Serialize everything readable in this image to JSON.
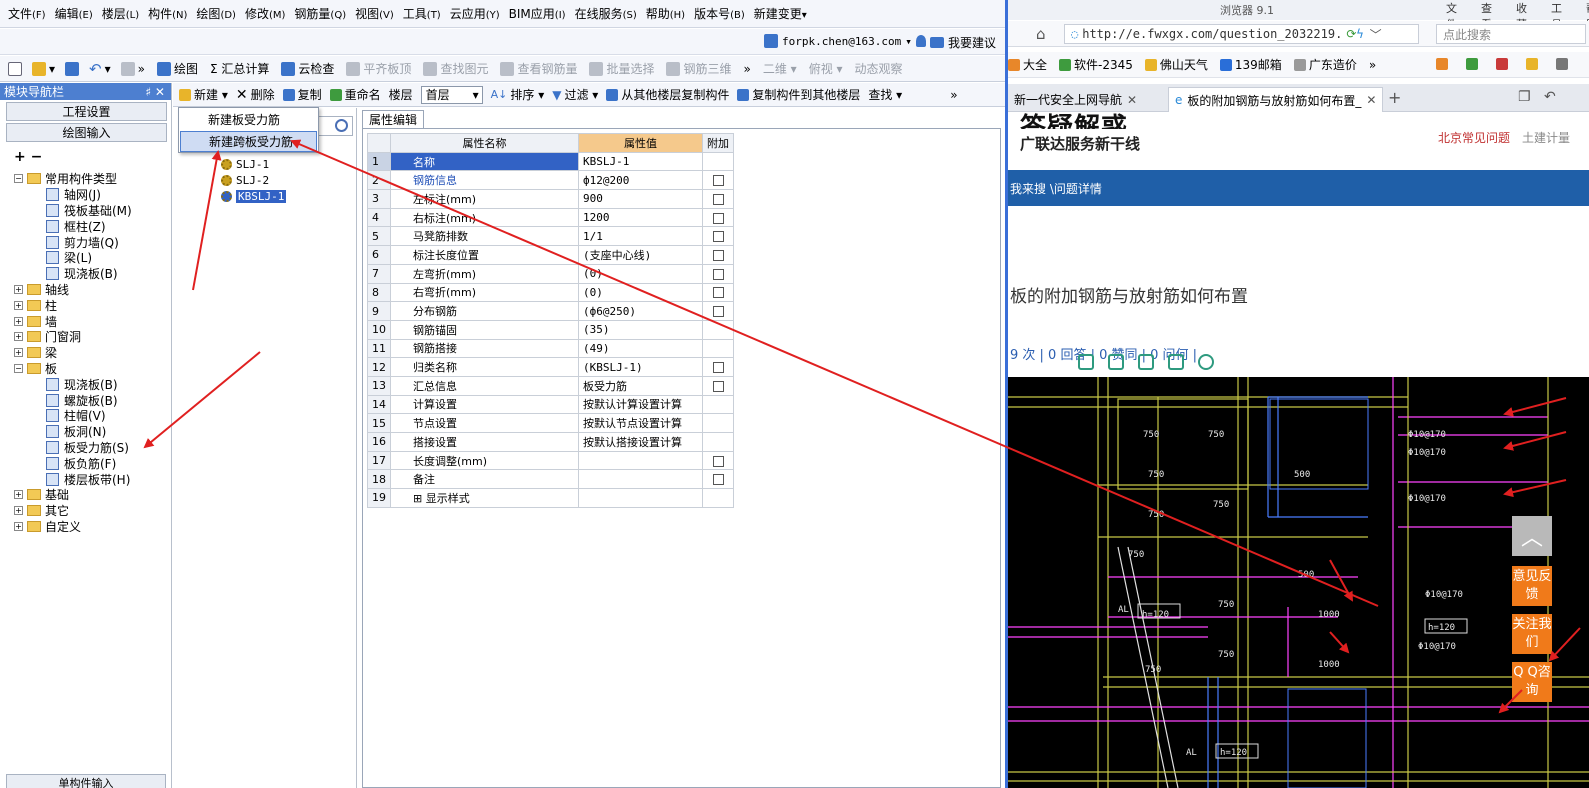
{
  "menubar": {
    "items": [
      {
        "label": "文件",
        "key": "(F)"
      },
      {
        "label": "编辑",
        "key": "(E)"
      },
      {
        "label": "楼层",
        "key": "(L)"
      },
      {
        "label": "构件",
        "key": "(N)"
      },
      {
        "label": "绘图",
        "key": "(D)"
      },
      {
        "label": "修改",
        "key": "(M)"
      },
      {
        "label": "钢筋量",
        "key": "(Q)"
      },
      {
        "label": "视图",
        "key": "(V)"
      },
      {
        "label": "工具",
        "key": "(T)"
      },
      {
        "label": "云应用",
        "key": "(Y)"
      },
      {
        "label": "BIM应用",
        "key": "(I)"
      },
      {
        "label": "在线服务",
        "key": "(S)"
      },
      {
        "label": "帮助",
        "key": "(H)"
      },
      {
        "label": "版本号",
        "key": "(B)"
      },
      {
        "label": "新建变更",
        "key": "▾"
      }
    ]
  },
  "userbar": {
    "user": "forpk.chen@163.com",
    "advice": "我要建议"
  },
  "toolbar": {
    "items": [
      {
        "label": "»",
        "icon": "more-icon"
      },
      {
        "label": "绘图",
        "icon": "draw-icon"
      },
      {
        "label": "Σ 汇总计算",
        "icon": ""
      },
      {
        "label": "云检查",
        "icon": "cloud-check-icon"
      },
      {
        "label": "平齐板顶",
        "icon": "flush-top-icon",
        "disabled": true
      },
      {
        "label": "查找图元",
        "icon": "find-element-icon",
        "disabled": true
      },
      {
        "label": "查看钢筋量",
        "icon": "view-rebar-icon",
        "disabled": true
      },
      {
        "label": "批量选择",
        "icon": "batch-select-icon",
        "disabled": true
      },
      {
        "label": "钢筋三维",
        "icon": "rebar-3d-icon",
        "disabled": true
      },
      {
        "label": "»",
        "icon": ""
      },
      {
        "label": "二维 ▾",
        "icon": "",
        "disabled": true
      },
      {
        "label": "俯视 ▾",
        "icon": "",
        "disabled": true
      },
      {
        "label": "动态观察",
        "icon": "",
        "disabled": true
      }
    ]
  },
  "nav": {
    "title": "模块导航栏",
    "title_controls": "♯ ✕",
    "engineering": "工程设置",
    "drawing_input": "绘图输入",
    "plusminus": "+ −",
    "bottom": "单构件输入",
    "tree": [
      {
        "label": "常用构件类型",
        "level": 0,
        "exp": "−"
      },
      {
        "label": "轴网(J)",
        "level": 1
      },
      {
        "label": "筏板基础(M)",
        "level": 1
      },
      {
        "label": "框柱(Z)",
        "level": 1
      },
      {
        "label": "剪力墙(Q)",
        "level": 1
      },
      {
        "label": "梁(L)",
        "level": 1
      },
      {
        "label": "现浇板(B)",
        "level": 1
      },
      {
        "label": "轴线",
        "level": 0,
        "exp": "+"
      },
      {
        "label": "柱",
        "level": 0,
        "exp": "+"
      },
      {
        "label": "墙",
        "level": 0,
        "exp": "+"
      },
      {
        "label": "门窗洞",
        "level": 0,
        "exp": "+"
      },
      {
        "label": "梁",
        "level": 0,
        "exp": "+"
      },
      {
        "label": "板",
        "level": 0,
        "exp": "−"
      },
      {
        "label": "现浇板(B)",
        "level": 1
      },
      {
        "label": "螺旋板(B)",
        "level": 1
      },
      {
        "label": "柱帽(V)",
        "level": 1
      },
      {
        "label": "板洞(N)",
        "level": 1
      },
      {
        "label": "板受力筋(S)",
        "level": 1
      },
      {
        "label": "板负筋(F)",
        "level": 1
      },
      {
        "label": "楼层板带(H)",
        "level": 1
      },
      {
        "label": "基础",
        "level": 0,
        "exp": "+"
      },
      {
        "label": "其它",
        "level": 0,
        "exp": "+"
      },
      {
        "label": "自定义",
        "level": 0,
        "exp": "+"
      }
    ]
  },
  "midtb": {
    "new": "新建 ▾",
    "delete": "删除",
    "copy": "复制",
    "rename": "重命名",
    "floor_label": "楼层",
    "floor_value": "首层",
    "sort": "排序 ▾",
    "filter": "过滤 ▾",
    "copy_from": "从其他楼层复制构件",
    "copy_to": "复制构件到其他楼层",
    "find": "查找 ▾",
    "more": "»"
  },
  "dropdown": {
    "item1": "新建板受力筋",
    "item2": "新建跨板受力筋"
  },
  "components": [
    {
      "label": "SLJ-1",
      "selected": false
    },
    {
      "label": "SLJ-2",
      "selected": false
    },
    {
      "label": "KBSLJ-1",
      "selected": true
    }
  ],
  "prop": {
    "tab": "属性编辑",
    "headers": {
      "name": "属性名称",
      "value": "属性值",
      "add": "附加"
    },
    "rows": [
      {
        "n": "1",
        "name": "名称",
        "value": "KBSLJ-1",
        "cb": false,
        "sel": true
      },
      {
        "n": "2",
        "name": "钢筋信息",
        "value": "ф12@200",
        "cb": true,
        "blue": true
      },
      {
        "n": "3",
        "name": "左标注(mm)",
        "value": "900",
        "cb": true
      },
      {
        "n": "4",
        "name": "右标注(mm)",
        "value": "1200",
        "cb": true
      },
      {
        "n": "5",
        "name": "马凳筋排数",
        "value": "1/1",
        "cb": true
      },
      {
        "n": "6",
        "name": "标注长度位置",
        "value": "(支座中心线)",
        "cb": true
      },
      {
        "n": "7",
        "name": "左弯折(mm)",
        "value": "(0)",
        "cb": true
      },
      {
        "n": "8",
        "name": "右弯折(mm)",
        "value": "(0)",
        "cb": true
      },
      {
        "n": "9",
        "name": "分布钢筋",
        "value": "(ф6@250)",
        "cb": true
      },
      {
        "n": "10",
        "name": "钢筋锚固",
        "value": "(35)",
        "cb": false
      },
      {
        "n": "11",
        "name": "钢筋搭接",
        "value": "(49)",
        "cb": false
      },
      {
        "n": "12",
        "name": "归类名称",
        "value": "(KBSLJ-1)",
        "cb": true
      },
      {
        "n": "13",
        "name": "汇总信息",
        "value": "板受力筋",
        "cb": true
      },
      {
        "n": "14",
        "name": "计算设置",
        "value": "按默认计算设置计算",
        "cb": false
      },
      {
        "n": "15",
        "name": "节点设置",
        "value": "按默认节点设置计算",
        "cb": false
      },
      {
        "n": "16",
        "name": "搭接设置",
        "value": "按默认搭接设置计算",
        "cb": false
      },
      {
        "n": "17",
        "name": "长度调整(mm)",
        "value": "",
        "cb": true
      },
      {
        "n": "18",
        "name": "备注",
        "value": "",
        "cb": true
      },
      {
        "n": "19",
        "name": "⊞ 显示样式",
        "value": "",
        "cb": false
      }
    ]
  },
  "browser": {
    "title_partial": "浏览器 9.1",
    "menus": [
      "文件",
      "查看",
      "收藏",
      "工具",
      "帮助"
    ],
    "url": "http://e.fwxgx.com/question_2032219.",
    "search_placeholder": "点此搜索",
    "bookmarks": [
      "大全",
      "软件-2345",
      "佛山天气",
      "139邮箱",
      "广东造价",
      "»"
    ],
    "tab1": "新一代安全上网导航",
    "tab2": "板的附加钢筋与放射筋如何布置_",
    "tab_close": "✕",
    "tab_plus": "+",
    "logo": "答疑解惑",
    "slogan": "广联达服务新干线",
    "top_link1": "北京常见问题",
    "top_link2": "土建计量",
    "nav_text": "我来搜 \\问题详情",
    "question_title": "板的附加钢筋与放射筋如何布置",
    "stats": "9 次 | 0 回答 | 0 赞同 | 0 问何 |",
    "side": {
      "up": "︿",
      "feedback": "意见反馈",
      "follow": "关注我们",
      "qq": "Q Q咨询"
    }
  },
  "cad": {
    "labels": [
      "750",
      "750",
      "750",
      "750",
      "750",
      "750",
      "500",
      "500",
      "750",
      "750",
      "750",
      "1000",
      "1000",
      "AL",
      "h=120",
      "AL",
      "h=120",
      "h=120"
    ],
    "rebar_labels": [
      "Φ10@170",
      "Φ10@170",
      "Φ10@170",
      "Φ10@170",
      "Φ10@170"
    ]
  },
  "colors": {
    "accent": "#3262c5",
    "arrow": "#e02020",
    "header_orange": "#f5c98c",
    "site_blue": "#1f5fa8",
    "side_orange": "#f07a1a"
  }
}
